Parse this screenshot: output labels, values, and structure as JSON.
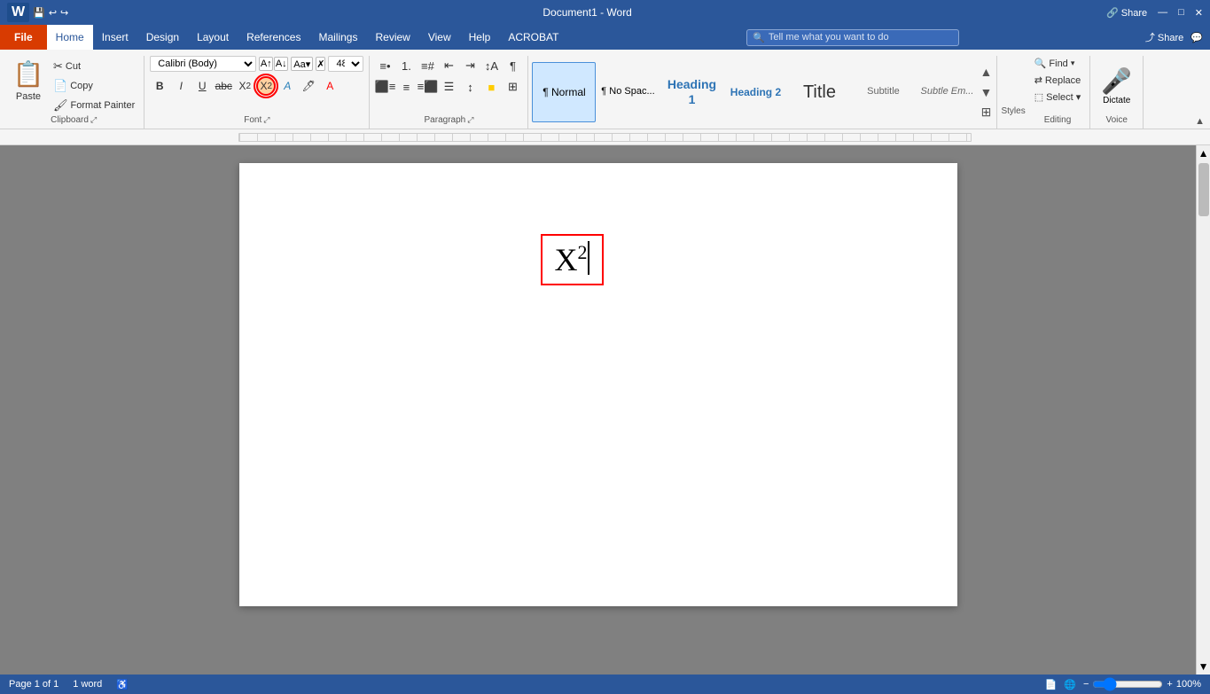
{
  "title_bar": {
    "doc_title": "Document1 - Word",
    "share_label": "Share",
    "search_placeholder": "Tell me what you want to do"
  },
  "menu": {
    "file": "File",
    "home": "Home",
    "insert": "Insert",
    "design": "Design",
    "layout": "Layout",
    "references": "References",
    "mailings": "Mailings",
    "review": "Review",
    "view": "View",
    "help": "Help",
    "acrobat": "ACROBAT"
  },
  "clipboard": {
    "group_label": "Clipboard",
    "paste_label": "Paste",
    "cut_label": "Cut",
    "copy_label": "Copy",
    "format_painter_label": "Format Painter"
  },
  "font": {
    "group_label": "Font",
    "font_name": "Calibri (Body)",
    "font_size": "48",
    "bold_label": "B",
    "italic_label": "I",
    "underline_label": "U",
    "strikethrough_label": "abc",
    "subscript_label": "X₂",
    "superscript_label": "X²"
  },
  "paragraph": {
    "group_label": "Paragraph"
  },
  "styles": {
    "group_label": "Styles",
    "items": [
      {
        "preview": "¶ Normal",
        "name": "Normal",
        "active": true
      },
      {
        "preview": "¶ No Spac...",
        "name": "No Spac...",
        "active": false
      },
      {
        "preview": "Heading 1",
        "name": "Heading 1",
        "active": false,
        "style": "bold"
      },
      {
        "preview": "Heading 2",
        "name": "Heading 2",
        "active": false,
        "style": "bold"
      },
      {
        "preview": "Title",
        "name": "Title",
        "active": false,
        "style": "large"
      },
      {
        "preview": "Subtitle",
        "name": "Subtitle",
        "active": false
      },
      {
        "preview": "Subtle Em...",
        "name": "Subtle Em...",
        "active": false
      }
    ]
  },
  "editing": {
    "group_label": "Editing",
    "find_label": "Find",
    "replace_label": "Replace",
    "select_label": "Select ▾"
  },
  "voice": {
    "group_label": "Voice",
    "dictate_label": "Dictate"
  },
  "document": {
    "content_text": "X",
    "superscript": "2"
  },
  "status_bar": {
    "page_info": "Page 1 of 1",
    "word_count": "1 word",
    "zoom": "100%"
  }
}
